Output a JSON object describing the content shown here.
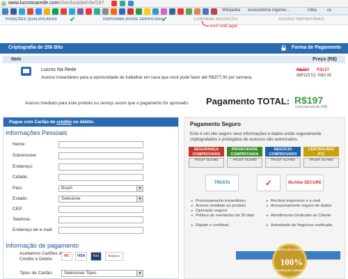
{
  "browser": {
    "url_host": "www.lucrosnarede.com",
    "url_path": "/checkout/pid=br/197",
    "bookmarks": [
      "Wikipedia",
      "ecossistema ingome...",
      "Ultra",
      "ce"
    ]
  },
  "steps": {
    "items": [
      "POSIÇÕES QUALIFICADAS",
      "DISPONIBILIDADE VERIFICADA",
      "CONFIRME INSCRIÇÃO",
      "ACESSO INSTANTÂNEO"
    ],
    "you_are_here": "você está aqui"
  },
  "crypto": {
    "title": "Criptografia de 256 Bits",
    "payment_form": "Forma de Pagamento"
  },
  "columns": {
    "item": "Item",
    "price": "Preço (R$)"
  },
  "product": {
    "name": "Lucros Na Rede",
    "description": "Acesso instantâneo para a oportunidade de trabalhar em casa que você pode fazer até R$377,00 por semana.",
    "old_price": "R$297",
    "new_price": "R$197",
    "tax": "IMPOSTO: R$0.00"
  },
  "summary": {
    "access_note": "Acesso imediato para este produto ou serviço assim que o pagamento for aprovado.",
    "total_label": "Pagamento TOTAL:",
    "total_value": "R$197",
    "installments": "Uma parcela de (R$)"
  },
  "form": {
    "header_prefix": "Pague com Cartão de ",
    "header_link": "crédito",
    "header_suffix": " ou débito.",
    "personal_title": "Informações Pessoais",
    "fields": {
      "name": "Nome:",
      "surname": "Sobrenome:",
      "address": "Endereço:",
      "city": "Cidade:",
      "country": "País:",
      "state": "Estado:",
      "zip": "CEP:",
      "phone": "Telefone:",
      "email": "Endereço de e-mail:"
    },
    "country_value": "Brazil",
    "state_value": "Selecione",
    "payment_title": "Informação de pagamento",
    "cards_label": "Aceitamos Cartões de Crédito e Débito",
    "card_type_label": "Tipos de Cartão:",
    "card_type_value": "Selecionar Tipos",
    "cards": [
      "MC",
      "VISA",
      "itaú",
      "Bradesco"
    ]
  },
  "secure": {
    "title": "Pagamento Seguro",
    "text": "Este é um site seguro seus informações e dados estão seguramente criptografados e protegidos de acessos não autorizados.",
    "seals": [
      {
        "title": "SEGURANÇA",
        "sub": "COMPROVADA",
        "footer": "TRUST GUARD",
        "color": "#c0392b"
      },
      {
        "title": "PRIVACIDADE",
        "sub": "COMPROVADA",
        "footer": "TRUST GUARD",
        "color": "#3a8a2a"
      },
      {
        "title": "NEGÓCIO",
        "sub": "COMPROVADO",
        "footer": "TRUST GUARD",
        "color": "#1f5fa8"
      },
      {
        "title": "CERTIFICADO",
        "sub": "PCI",
        "footer": "TRUST GUARD",
        "color": "#c8a010"
      }
    ],
    "badges": [
      "TRUSTe",
      "✓",
      "McAfee SECURE"
    ],
    "features_left": [
      "Processamento instantâneo",
      "Acesso imediato ao produto",
      "Operação segura",
      "Política de reembolso de 30 dias",
      "Rápido e confiável"
    ],
    "features_right": [
      "Recibos impressos e e-mail",
      "Armazenamento seguro de dados",
      "Atendimento Dedicado ao Cliente",
      "Autoridade de Negócios verificada"
    ],
    "guarantee_top": "SATISFAÇÃO GARANTIDA",
    "guarantee_pct": "100%",
    "guarantee_bottom": "SATISFAÇÃO GARANTIDA"
  }
}
